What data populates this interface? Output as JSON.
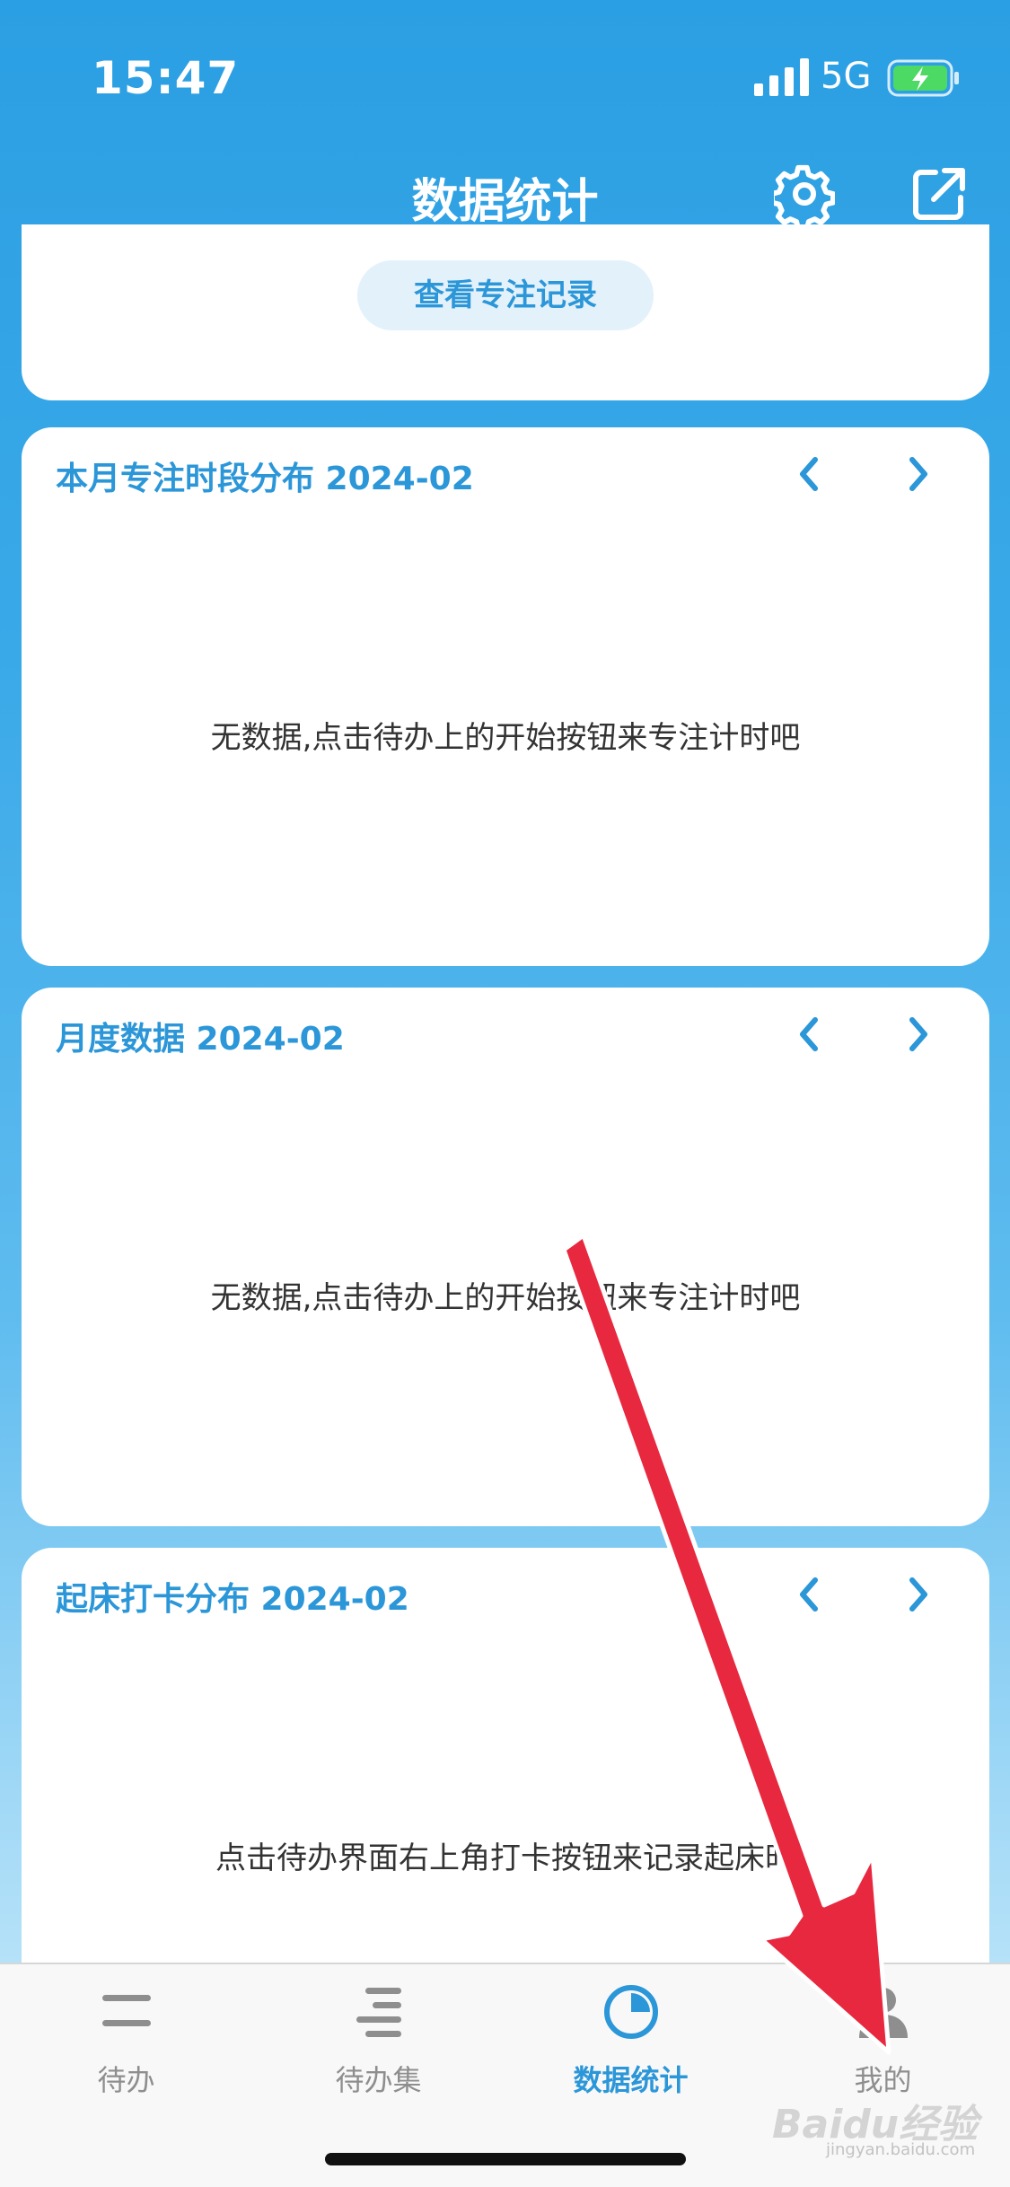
{
  "status": {
    "time": "15:47",
    "network": "5G"
  },
  "nav": {
    "title": "数据统计"
  },
  "top_card": {
    "record_button": "查看专注记录"
  },
  "cards": [
    {
      "title": "本月专注时段分布  2024-02",
      "empty_text": "无数据,点击待办上的开始按钮来专注计时吧"
    },
    {
      "title": "月度数据 2024-02",
      "empty_text": "无数据,点击待办上的开始按钮来专注计时吧"
    },
    {
      "title": "起床打卡分布 2024-02",
      "empty_text": "点击待办界面右上角打卡按钮来记录起床时"
    }
  ],
  "tabs": [
    {
      "label": "待办",
      "icon": "list-icon",
      "active": false
    },
    {
      "label": "待办集",
      "icon": "list-collection-icon",
      "active": false
    },
    {
      "label": "数据统计",
      "icon": "pie-chart-icon",
      "active": true
    },
    {
      "label": "我的",
      "icon": "person-icon",
      "active": false
    }
  ],
  "watermark": {
    "text": "Baidu经验",
    "sub": "jingyan.baidu.com"
  },
  "colors": {
    "accent": "#2b96d8",
    "annotation_arrow": "#e8283f",
    "inactive": "#8e8e8e"
  }
}
